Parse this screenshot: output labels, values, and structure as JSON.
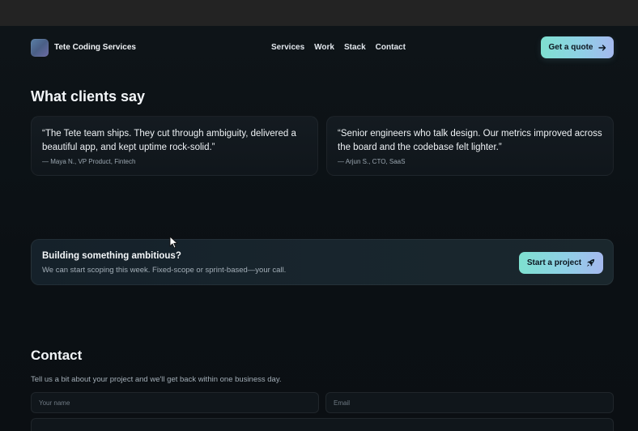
{
  "nav": {
    "brand": "Tete Coding Services",
    "links": [
      "Services",
      "Work",
      "Stack",
      "Contact"
    ],
    "cta_label": "Get a quote",
    "cta_icon": "arrow-right-icon"
  },
  "testimonials": {
    "title": "What clients say",
    "items": [
      {
        "quote": "“The Tete team ships. They cut through ambiguity, delivered a beautiful app, and kept uptime rock-solid.”",
        "author": "— Maya N., VP Product, Fintech"
      },
      {
        "quote": "“Senior engineers who talk design. Our metrics improved across the board and the codebase felt lighter.”",
        "author": "— Arjun S., CTO, SaaS"
      }
    ]
  },
  "cta_banner": {
    "title": "Building something ambitious?",
    "subtitle": "We can start scoping this week. Fixed-scope or sprint-based—your call.",
    "button_label": "Start a project",
    "button_icon": "rocket-icon"
  },
  "contact": {
    "title": "Contact",
    "subtitle": "Tell us a bit about your project and we'll get back within one business day.",
    "name_placeholder": "Your name",
    "email_placeholder": "Email"
  },
  "colors": {
    "background": "#0b0f13",
    "accent_start": "#7ee0d0",
    "accent_end": "#a5b9ee"
  }
}
